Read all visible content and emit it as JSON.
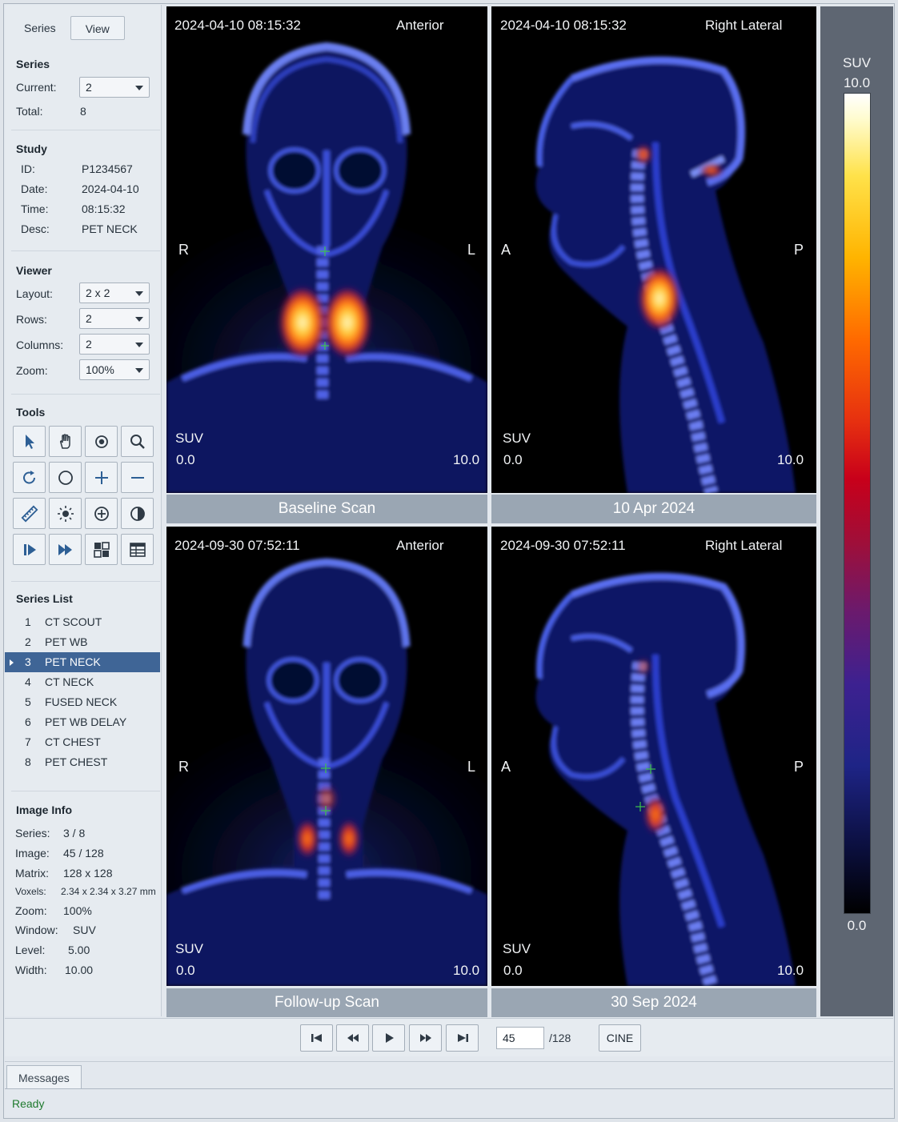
{
  "tabs": {
    "series": "Series",
    "view": "View"
  },
  "series_section": {
    "title": "Series",
    "current_label": "Current:",
    "current_value": "2",
    "total_label": "Total:",
    "total_value": "8"
  },
  "study": {
    "title": "Study",
    "id_label": "ID:",
    "id": "P1234567",
    "date_label": "Date:",
    "date": "2024-04-10",
    "time_label": "Time:",
    "time": "08:15:32",
    "desc_label": "Desc:",
    "desc": "PET NECK"
  },
  "viewer": {
    "title": "Viewer",
    "layout_label": "Layout:",
    "layout": "2 x 2",
    "rows_label": "Rows:",
    "rows": "2",
    "columns_label": "Columns:",
    "columns": "2",
    "zoom_label": "Zoom:",
    "zoom": "100%"
  },
  "tools": {
    "title": "Tools",
    "items": [
      "pointer-icon",
      "pan-hand-icon",
      "roi-target-icon",
      "magnify-icon",
      "rotate-icon",
      "ellipse-icon",
      "zoom-in-plus-icon",
      "zoom-out-minus-icon",
      "ruler-icon",
      "brightness-icon",
      "center-icon",
      "contrast-icon",
      "step-play-icon",
      "fast-forward-icon",
      "layout-grid-icon",
      "table-grid-icon"
    ]
  },
  "series_list": {
    "title": "Series List",
    "items": [
      {
        "n": "1",
        "name": "CT SCOUT"
      },
      {
        "n": "2",
        "name": "PET WB"
      },
      {
        "n": "3",
        "name": "PET NECK"
      },
      {
        "n": "4",
        "name": "CT NECK"
      },
      {
        "n": "5",
        "name": "FUSED NECK"
      },
      {
        "n": "6",
        "name": "PET WB DELAY"
      },
      {
        "n": "7",
        "name": "CT CHEST"
      },
      {
        "n": "8",
        "name": "PET CHEST"
      }
    ],
    "selected_index": 2
  },
  "image_info": {
    "title": "Image Info",
    "series_label": "Series:",
    "series": "3 / 8",
    "image_label": "Image:",
    "image": "45 / 128",
    "matrix_label": "Matrix:",
    "matrix": "128 x 128",
    "voxels_label": "Voxels:",
    "voxels": "2.34 x 2.34 x 3.27 mm",
    "zoom_label": "Zoom:",
    "zoom": "100%",
    "window_label": "Window:",
    "window": "SUV",
    "level_label": "Level:",
    "level": "5.00",
    "width_label": "Width:",
    "width": "10.00"
  },
  "viewports": [
    {
      "timestamp": "2024-04-10  08:15:32",
      "view": "Anterior",
      "left": "R",
      "right": "L",
      "suv": "SUV",
      "min": "0.0",
      "max": "10.0",
      "caption": "Baseline Scan"
    },
    {
      "timestamp": "2024-04-10  08:15:32",
      "view": "Right Lateral",
      "left": "A",
      "right": "P",
      "suv": "SUV",
      "min": "0.0",
      "max": "10.0",
      "caption": "10 Apr 2024"
    },
    {
      "timestamp": "2024-09-30  07:52:11",
      "view": "Anterior",
      "left": "R",
      "right": "L",
      "suv": "SUV",
      "min": "0.0",
      "max": "10.0",
      "caption": "Follow-up Scan"
    },
    {
      "timestamp": "2024-09-30  07:52:11",
      "view": "Right Lateral",
      "left": "A",
      "right": "P",
      "suv": "SUV",
      "min": "0.0",
      "max": "10.0",
      "caption": "30 Sep 2024"
    }
  ],
  "colorbar": {
    "title": "SUV",
    "max": "10.0",
    "min": "0.0"
  },
  "playback": {
    "frame": "45",
    "total": "/128",
    "cine": "CINE"
  },
  "messages": {
    "tab": "Messages",
    "status": "Ready"
  }
}
